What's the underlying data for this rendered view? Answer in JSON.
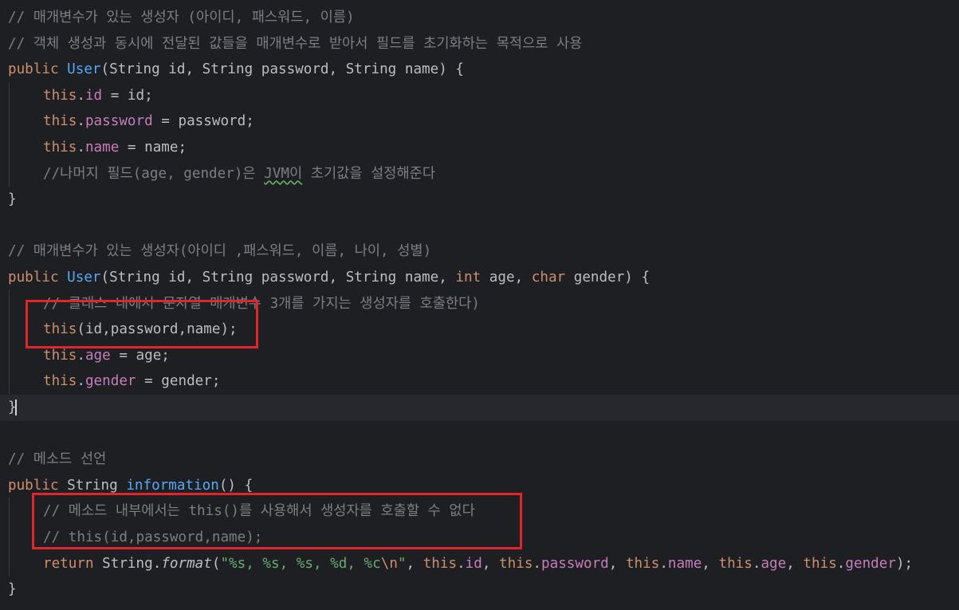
{
  "lines": [
    {
      "text": "// 매개변수가 있는 생성자 (아이디, 패스워드, 이름)"
    },
    {
      "text": "// 객체 생성과 동시에 전달된 값들을 매개변수로 받아서 필드를 초기화하는 목적으로 사용"
    },
    {
      "k1": "public",
      "fn": "User",
      "rest": "(String id, String password, String name) {"
    },
    {
      "kw": "this",
      "dot": ".",
      "field": "id",
      "rest": " = id;"
    },
    {
      "kw": "this",
      "dot": ".",
      "field": "password",
      "rest": " = password;"
    },
    {
      "kw": "this",
      "dot": ".",
      "field": "name",
      "rest": " = name;"
    },
    {
      "pre": "//나머지 필드(age, gender)은 ",
      "warn": "JVM이",
      "post": " 초기값을 설정해준다"
    },
    {
      "text": "}"
    },
    {
      "text": ""
    },
    {
      "text": "// 매개변수가 있는 생성자(아이디 ,패스워드, 이름, 나이, 성별)"
    },
    {
      "k1": "public",
      "fn": "User",
      "a": "(String id, String password, String name, ",
      "k2": "int",
      "b": " age, ",
      "k3": "char",
      "c": " gender) {"
    },
    {
      "text": "// 클래스 내에서 문자열 매개변수 3개를 가지는 생성자를 호출한다)"
    },
    {
      "kw": "this",
      "rest": "(id,password,name);"
    },
    {
      "kw": "this",
      "dot": ".",
      "field": "age",
      "rest": " = age;"
    },
    {
      "kw": "this",
      "dot": ".",
      "field": "gender",
      "rest": " = gender;"
    },
    {
      "text": "}"
    },
    {
      "text": ""
    },
    {
      "text": "// 메소드 선언"
    },
    {
      "k1": "public",
      "type": " String ",
      "fn": "information",
      "rest": "() {"
    },
    {
      "text": "// 메소드 내부에서는 this()를 사용해서 생성자를 호출할 수 없다"
    },
    {
      "text": "// this(id,password,name);"
    },
    {
      "ret": "return",
      "cls": " String.",
      "method": "format",
      "open": "(",
      "str1": "\"%s, %s, %s, %d, %c",
      "esc": "\\n",
      "str2": "\"",
      "sep1": ", ",
      "t1": "this",
      "d1": ".",
      "f1": "id",
      "s1": ", ",
      "t2": "this",
      "d2": ".",
      "f2": "password",
      "s2": ", ",
      "t3": "this",
      "d3": ".",
      "f3": "name",
      "s3": ", ",
      "t4": "this",
      "d4": ".",
      "f4": "age",
      "s4": ", ",
      "t5": "this",
      "d5": ".",
      "f5": "gender",
      "end": ");"
    },
    {
      "text": "}"
    }
  ]
}
